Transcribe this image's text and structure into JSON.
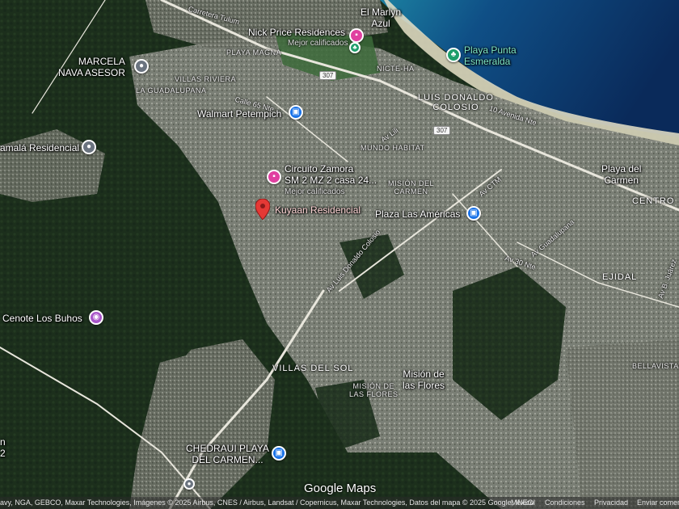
{
  "places": {
    "marlyn": "El Marlyn\nAzul",
    "nick_price": "Nick Price Residences",
    "nick_price_sub": "Mejor calificados",
    "punta_esmeralda": "Playa Punta\nEsmeralda",
    "marcela": "MARCELA\nNAVA ASESOR",
    "walmart": "Walmart Petempich",
    "kamala": "amalá Residencial",
    "circuito": "Circuito Zamora\nSM 2 MZ 2 casa 24...",
    "circuito_sub": "Mejor calificados",
    "kuyaan": "Kuyaan Residencial",
    "plaza": "Plaza Las Américas",
    "cenote": "Cenote Los Buhos",
    "chedraui": "CHEDRAUI PLAYA\nDEL CARMEN...",
    "playa_carmen": "Playa del\nCarmen",
    "mision_flores": "Misión de\nlas Flores",
    "left_edge": "n\n2"
  },
  "areas": {
    "playa_magna": "PLAYA MAGNA",
    "villas_riviera": "VILLAS RIVIERA",
    "guadalupana": "LA GUADALUPANA",
    "nicte_ha": "NICTE-HA",
    "luis_donaldo": "LUIS DONALDO\nCOLOSIO",
    "mundo_habitat": "MUNDO HABITAT",
    "mision_carmen": "MISIÓN DEL\nCARMEN",
    "centro": "CENTRO",
    "ejidal": "EJIDAL",
    "villas_sol": "VILLAS DEL SOL",
    "mision_flores_area": "MISIÓN DE\nLAS FLORES",
    "bellavista": "BELLAVISTA"
  },
  "streets": {
    "tulum": "Carretera Tulum",
    "calle65": "Calle 65 Nte",
    "av10": "10 Avenida Nte",
    "colosio": "Av Luis Donaldo Colosio",
    "av_ctm": "Av CTM",
    "av30": "Av 30 Nte",
    "av_guadalupe": "Av Guadalupana",
    "av_benito": "Av B. Juárez",
    "av_lili": "Av Lili"
  },
  "shields": {
    "r307a": "307",
    "r307b": "307"
  },
  "footer": {
    "attribution": "avy, NGA, GEBCO, Maxar Technologies, Imágenes © 2025 Airbus, CNES / Airbus, Landsat / Copernicus, Maxar Technologies, Datos del mapa © 2025 Google, INEGI",
    "mexico": "México",
    "terms": "Condiciones",
    "privacy": "Privacidad",
    "feedback": "Enviar comen"
  },
  "logo": "Google Maps",
  "colors": {
    "ocean_deep": "#0e3a6e",
    "ocean_shallow": "#2aa3b8",
    "jungle": "#1f3320",
    "urban": "#8d8f86",
    "lodging_pin": "#e040a0",
    "shopping_pin": "#1a73e8",
    "attraction_pin": "#a855c8",
    "park_pin": "#1e9e6a",
    "generic_pin": "#6b7480",
    "selected_pin": "#e53935"
  },
  "icons": {
    "lodging": "bed-icon",
    "shopping": "shopping-bag-icon",
    "attraction": "camera-icon",
    "park": "tree-icon",
    "generic": "location-icon",
    "selected": "map-marker-icon"
  }
}
